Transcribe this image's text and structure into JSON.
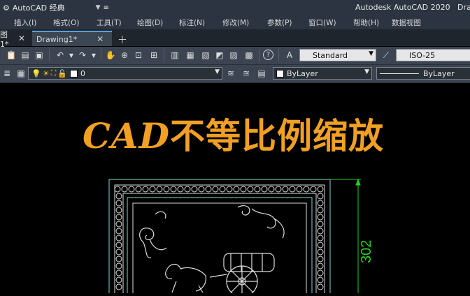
{
  "titlebar": {
    "workspace": "AutoCAD 经典",
    "app_title": "Autodesk AutoCAD 2020",
    "user": "Dra"
  },
  "menu": {
    "items": [
      "插入(I)",
      "格式(O)",
      "工具(T)",
      "绘图(D)",
      "标注(N)",
      "修改(M)",
      "参数(P)",
      "窗口(W)",
      "帮助(H)",
      "数据视图"
    ]
  },
  "tabs": {
    "items": [
      {
        "label": "图1*"
      },
      {
        "label": "Drawing1*"
      }
    ]
  },
  "toolbar1": {
    "text_style": "Standard",
    "dim_style": "ISO-25"
  },
  "toolbar2": {
    "layer": "0",
    "color": "ByLayer",
    "linetype": "ByLayer"
  },
  "canvas": {
    "overlay_title_latin": "CAD",
    "overlay_title_cn": "不等比例缩放",
    "dimension_value": "302"
  },
  "colors": {
    "overlay_title": "#f2a023",
    "dimension": "#20d020",
    "drawing_lines": "#ffffff",
    "frame_cyan": "#7fd6d6"
  }
}
